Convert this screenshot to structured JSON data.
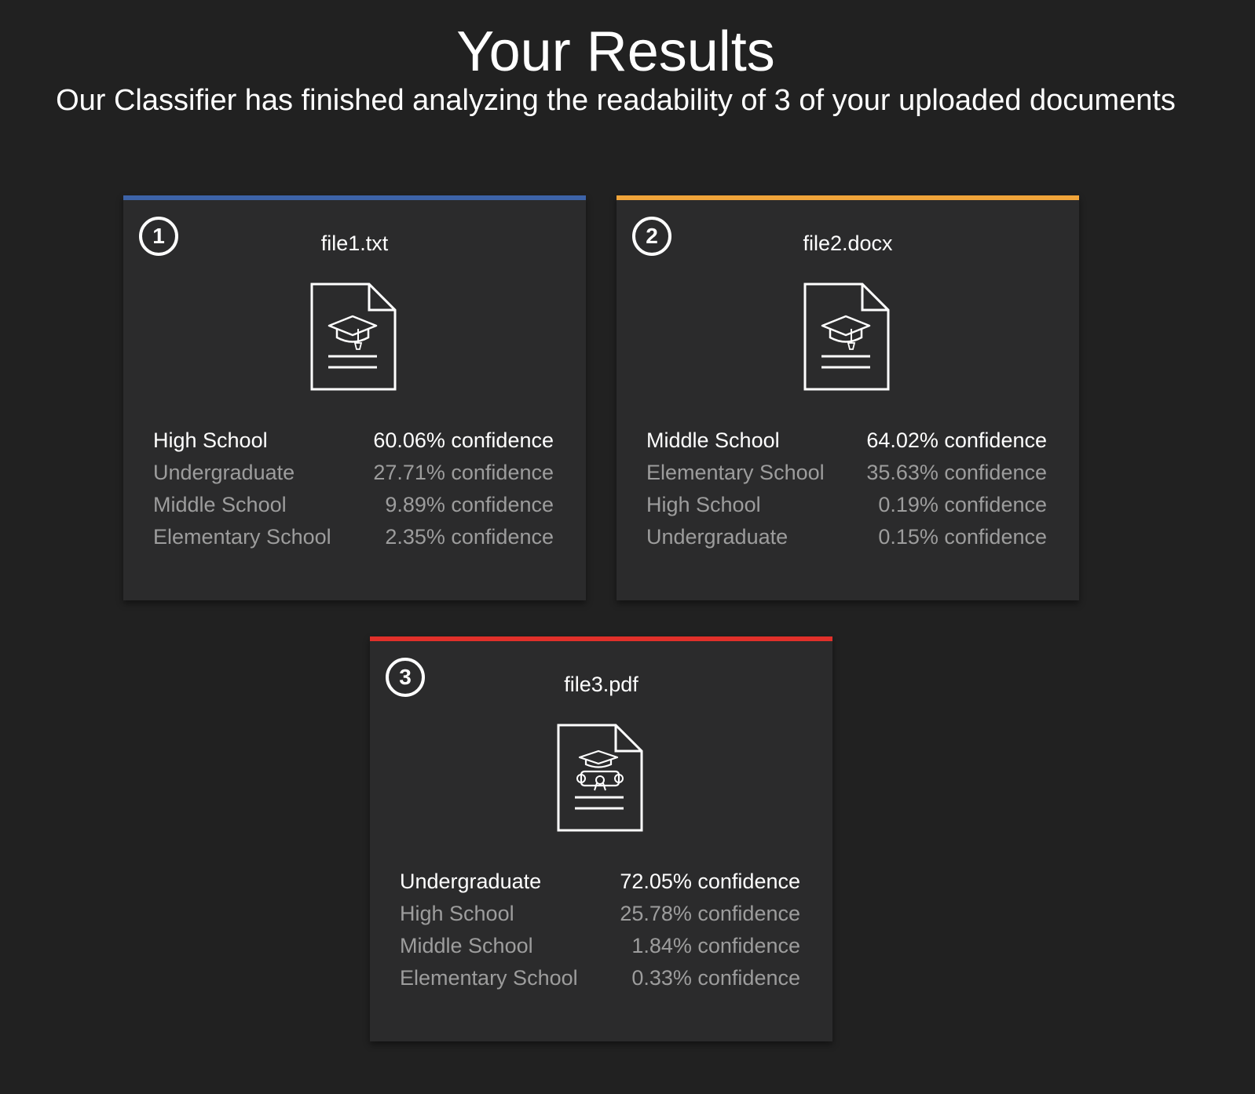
{
  "header": {
    "title": "Your Results",
    "subtitle": "Our Classifier has finished analyzing the readability of 3 of your uploaded documents"
  },
  "colors": {
    "background": "#212121",
    "card": "#2b2b2c",
    "accent_1": "#3d63a8",
    "accent_2": "#f0a43a",
    "accent_3": "#e1302a",
    "muted_text": "#9d9d9d"
  },
  "cards": [
    {
      "rank": "1",
      "file_name": "file1.txt",
      "icon": "graduation-cap-document-icon",
      "results": [
        {
          "label": "High School",
          "confidence": "60.06% confidence"
        },
        {
          "label": "Undergraduate",
          "confidence": "27.71% confidence"
        },
        {
          "label": "Middle School",
          "confidence": "9.89% confidence"
        },
        {
          "label": "Elementary School",
          "confidence": "2.35% confidence"
        }
      ]
    },
    {
      "rank": "2",
      "file_name": "file2.docx",
      "icon": "graduation-cap-document-icon",
      "results": [
        {
          "label": "Middle School",
          "confidence": "64.02% confidence"
        },
        {
          "label": "Elementary School",
          "confidence": "35.63% confidence"
        },
        {
          "label": "High School",
          "confidence": "0.19% confidence"
        },
        {
          "label": "Undergraduate",
          "confidence": "0.15% confidence"
        }
      ]
    },
    {
      "rank": "3",
      "file_name": "file3.pdf",
      "icon": "diploma-document-icon",
      "results": [
        {
          "label": "Undergraduate",
          "confidence": "72.05% confidence"
        },
        {
          "label": "High School",
          "confidence": "25.78% confidence"
        },
        {
          "label": "Middle School",
          "confidence": "1.84% confidence"
        },
        {
          "label": "Elementary School",
          "confidence": "0.33% confidence"
        }
      ]
    }
  ]
}
